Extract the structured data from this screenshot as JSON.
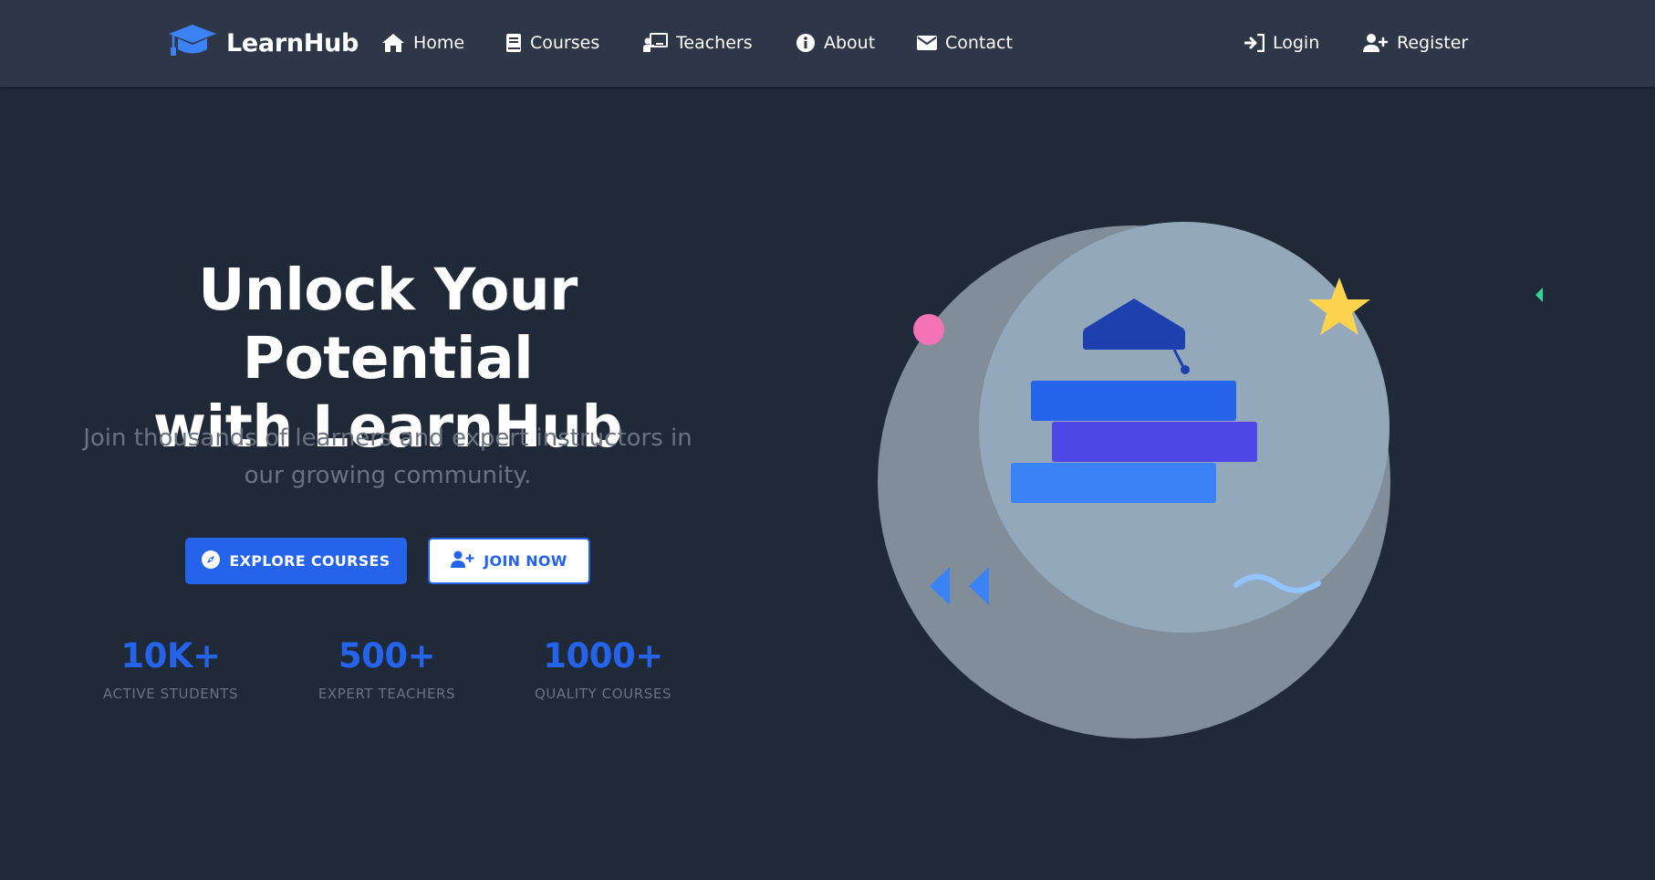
{
  "brand": {
    "name": "LearnHub",
    "logo_icon": "graduation-cap-icon",
    "accent": "#3b82f6"
  },
  "nav": {
    "items": [
      {
        "label": "Home",
        "icon": "home-icon"
      },
      {
        "label": "Courses",
        "icon": "book-icon"
      },
      {
        "label": "Teachers",
        "icon": "chalkboard-teacher-icon"
      },
      {
        "label": "About",
        "icon": "info-icon"
      },
      {
        "label": "Contact",
        "icon": "envelope-icon"
      }
    ],
    "auth": [
      {
        "label": "Login",
        "icon": "sign-in-icon"
      },
      {
        "label": "Register",
        "icon": "user-plus-icon"
      }
    ]
  },
  "hero": {
    "title_line1": "Unlock Your Potential",
    "title_line2": "with LearnHub",
    "subtitle": "Join thousands of learners and expert instructors in our growing community.",
    "primary_button": {
      "label": "EXPLORE COURSES",
      "icon": "compass-icon"
    },
    "secondary_button": {
      "label": "JOIN NOW",
      "icon": "user-plus-icon"
    }
  },
  "stats": [
    {
      "value": "10K+",
      "label": "ACTIVE STUDENTS"
    },
    {
      "value": "500+",
      "label": "EXPERT TEACHERS"
    },
    {
      "value": "1000+",
      "label": "QUALITY COURSES"
    }
  ],
  "colors": {
    "background": "#1f2937",
    "navbar": "#2e3748",
    "primary": "#2563eb",
    "muted_text": "#6b7280",
    "star": "#fcd34d",
    "pink_dot": "#f472b6",
    "green_triangle": "#34d399"
  }
}
